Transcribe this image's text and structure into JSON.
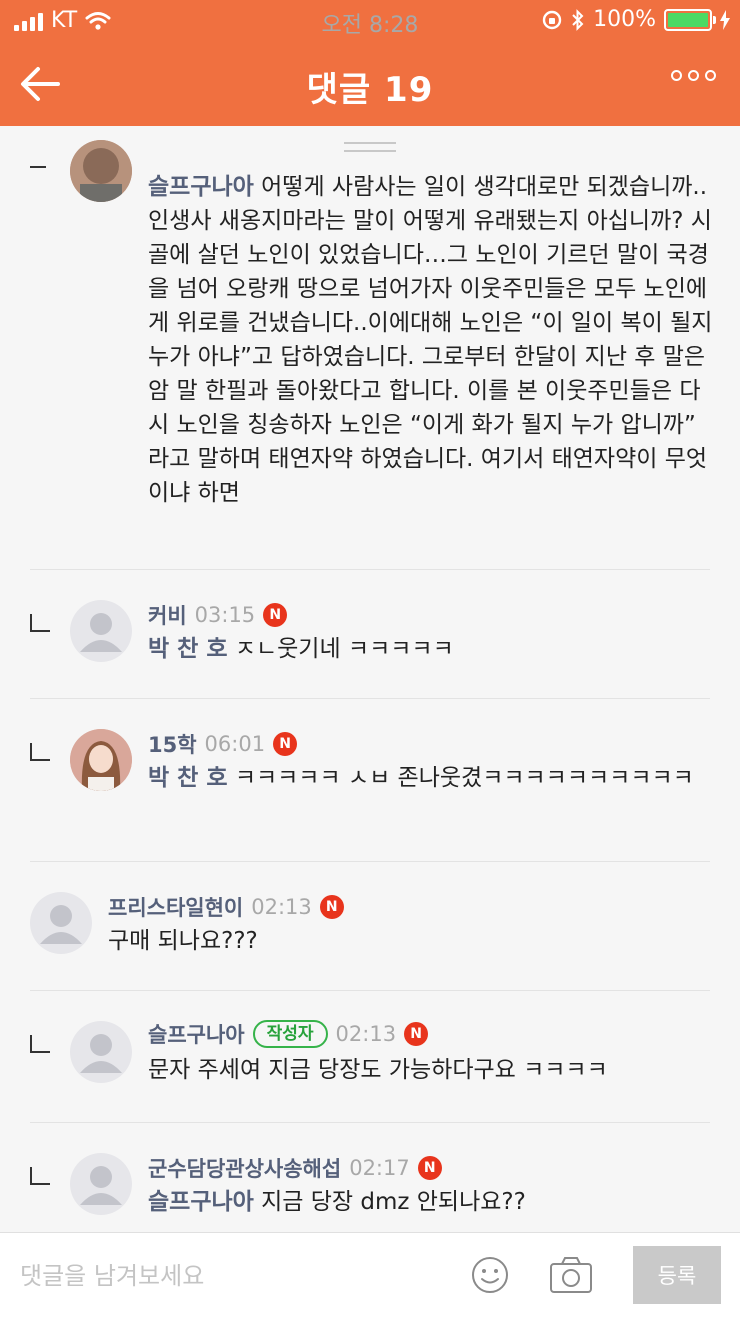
{
  "status_bar": {
    "carrier": "KT",
    "time": "오전 8:28",
    "battery": "100%"
  },
  "header": {
    "title": "댓글 19"
  },
  "comments": [
    {
      "mention": "슬프구나아",
      "text": "어떻게 사람사는 일이 생각대로만 되겠습니까..인생사 새옹지마라는 말이 어떻게 유래됐는지 아십니까? 시골에 살던 노인이 있었습니다…그 노인이 기르던 말이 국경을 넘어 오랑캐 땅으로 넘어가자 이웃주민들은 모두 노인에게 위로를 건냈습니다..이에대해 노인은 “이 일이 복이 될지 누가 아냐”고 답하였습니다. 그로부터 한달이 지난 후 말은 암 말 한필과 돌아왔다고 합니다. 이를 본 이웃주민들은 다시 노인을 칭송하자 노인은 “이게 화가 될지 누가 압니까” 라고 말하며 태연자약 하였습니다. 여기서 태연자약이 무엇이냐 하면"
    },
    {
      "nickname": "커비",
      "time": "03:15",
      "badge": "N",
      "mention": "박 찬 호",
      "text": "ㅈㄴ웃기네 ㅋㅋㅋㅋㅋ"
    },
    {
      "nickname": "15학",
      "time": "06:01",
      "badge": "N",
      "mention": "박 찬 호",
      "text": "ㅋㅋㅋㅋㅋ ㅅㅂ 존나웃겼ㅋㅋㅋㅋㅋㅋㅋㅋㅋㅋ"
    },
    {
      "nickname": "프리스타일현이",
      "time": "02:13",
      "badge": "N",
      "text": "구매 되나요???"
    },
    {
      "nickname": "슬프구나아",
      "author_label": "작성자",
      "time": "02:13",
      "badge": "N",
      "text": "문자 주세여 지금 당장도 가능하다구요 ㅋㅋㅋㅋ"
    },
    {
      "nickname": "군수담당관상사송해섭",
      "time": "02:17",
      "badge": "N",
      "mention": "슬프구나아",
      "text": "지금 당장 dmz 안되나요??"
    }
  ],
  "input_bar": {
    "placeholder": "댓글을 남겨보세요",
    "submit_label": "등록"
  },
  "colors": {
    "brand": "#f07040",
    "nickname": "#55607a",
    "new_badge": "#e8341c",
    "author_badge": "#36b34a"
  }
}
